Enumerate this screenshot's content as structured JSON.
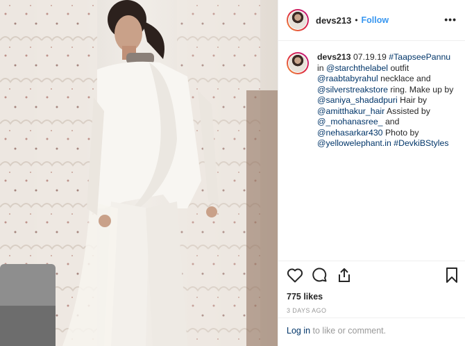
{
  "post": {
    "username": "devs213",
    "follow_label": "Follow",
    "separator": "•",
    "more_label": "•••"
  },
  "caption": {
    "username": "devs213",
    "parts": [
      {
        "text": " 07.19.19 ",
        "link": false
      },
      {
        "text": "#TaapseePannu",
        "link": true
      },
      {
        "text": " in ",
        "link": false
      },
      {
        "text": "@starchthelabel",
        "link": true
      },
      {
        "text": " outfit ",
        "link": false
      },
      {
        "text": "@raabtabyrahul",
        "link": true
      },
      {
        "text": " necklace and ",
        "link": false
      },
      {
        "text": "@silverstreakstore",
        "link": true
      },
      {
        "text": " ring. Make up by ",
        "link": false
      },
      {
        "text": "@saniya_shadadpuri",
        "link": true
      },
      {
        "text": " Hair by ",
        "link": false
      },
      {
        "text": "@amitthakur_hair",
        "link": true
      },
      {
        "text": " Assisted by ",
        "link": false
      },
      {
        "text": "@_mohanasree_",
        "link": true
      },
      {
        "text": " and ",
        "link": false
      },
      {
        "text": "@nehasarkar430",
        "link": true
      },
      {
        "text": " Photo by ",
        "link": false
      },
      {
        "text": "@yellowelephant.in",
        "link": true
      },
      {
        "text": " ",
        "link": false
      },
      {
        "text": "#DevkiBStyles",
        "link": true
      }
    ]
  },
  "stats": {
    "likes": "775 likes",
    "time": "3 DAYS AGO"
  },
  "footer": {
    "login_link": "Log in",
    "rest": " to like or comment."
  },
  "icons": {
    "like": "heart-icon",
    "comment": "comment-icon",
    "share": "share-icon",
    "save": "bookmark-icon"
  },
  "colors": {
    "link": "#003569",
    "follow": "#3897f0",
    "muted": "#999999"
  }
}
